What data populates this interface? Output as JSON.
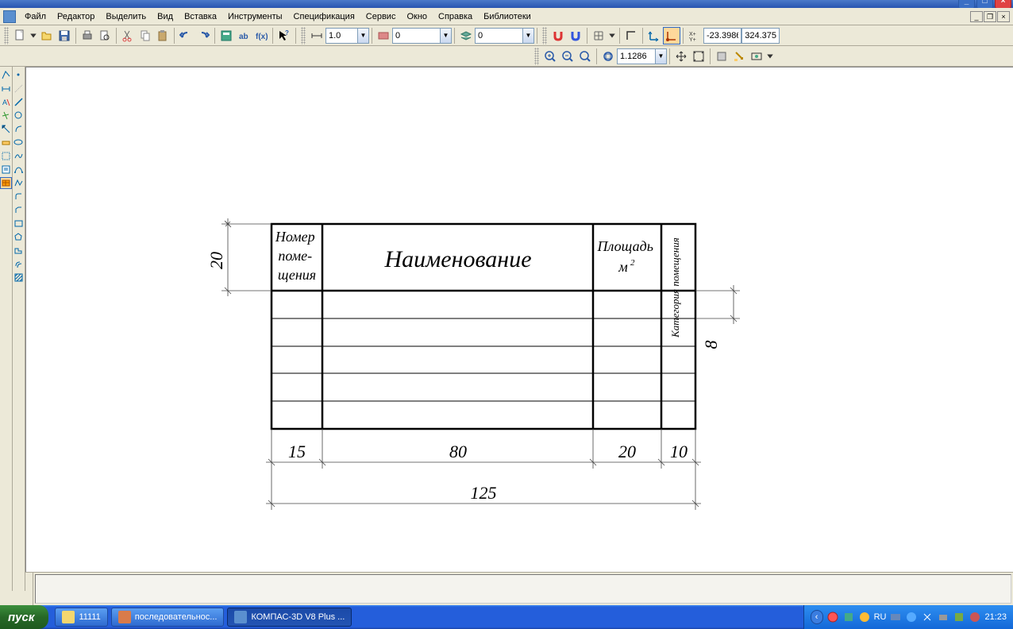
{
  "menu": {
    "file": "Файл",
    "editor": "Редактор",
    "select": "Выделить",
    "view": "Вид",
    "insert": "Вставка",
    "tools": "Инструменты",
    "spec": "Спецификация",
    "service": "Сервис",
    "window": "Окно",
    "help": "Справка",
    "libs": "Библиотеки"
  },
  "toolbar": {
    "step_value": "1.0",
    "style_value": "0",
    "snap_value": "0",
    "coord_x": "-23.3986",
    "coord_y": "324.375",
    "zoom_value": "1.1286"
  },
  "drawing": {
    "headers": {
      "col1": "Номер поме- щения",
      "col2": "Наименование",
      "col3_line1": "Площадь",
      "col3_line2": "м",
      "col3_sup": "2",
      "col4": "Категория помещения"
    },
    "row_height": "20",
    "cell_row": "8",
    "dim_col1": "15",
    "dim_col2": "80",
    "dim_col3": "20",
    "dim_col4": "10",
    "dim_total": "125"
  },
  "taskbar": {
    "start": "пуск",
    "task1": "11111",
    "task2": "последовательнос...",
    "task3": "КОМПАС-3D V8 Plus ...",
    "lang": "RU",
    "clock": "21:23"
  }
}
